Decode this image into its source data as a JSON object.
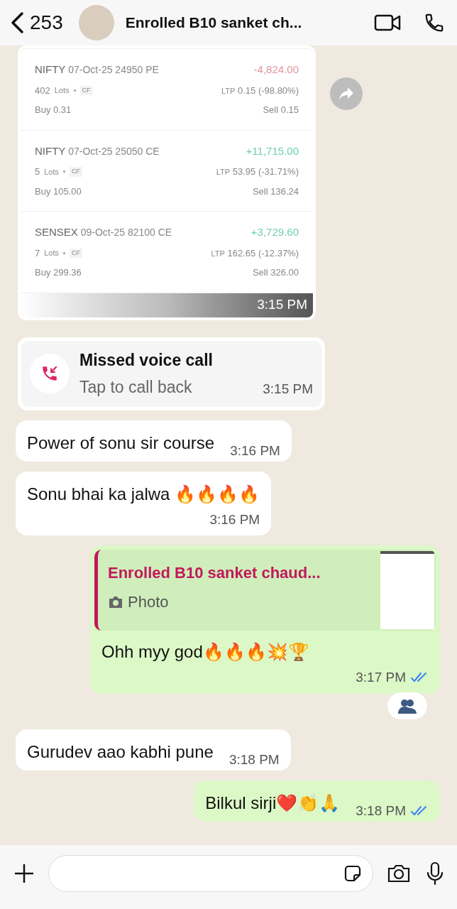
{
  "header": {
    "back_count": "253",
    "title": "Enrolled B10 sanket ch..."
  },
  "messages": [
    {
      "kind": "image",
      "time": "3:15 PM",
      "trades": [
        {
          "symbol": "NIFTY",
          "contract": "07-Oct-25 24950 PE",
          "pnl": "-4,824.00",
          "color": "#e2949c",
          "lots": "402",
          "lots_label": "Lots",
          "tag": "CF",
          "ltp_label": "LTP",
          "ltp": "0.15 (-98.80%)",
          "buy": "Buy 0.31",
          "sell": "Sell 0.15"
        },
        {
          "symbol": "NIFTY",
          "contract": "07-Oct-25 25050 CE",
          "pnl": "+11,715.00",
          "color": "#6fcfae",
          "lots": "5",
          "lots_label": "Lots",
          "tag": "CF",
          "ltp_label": "LTP",
          "ltp": "53.95 (-31.71%)",
          "buy": "Buy 105.00",
          "sell": "Sell 136.24"
        },
        {
          "symbol": "SENSEX",
          "contract": "09-Oct-25 82100 CE",
          "pnl": "+3,729.60",
          "color": "#6fcfae",
          "lots": "7",
          "lots_label": "Lots",
          "tag": "CF",
          "ltp_label": "LTP",
          "ltp": "162.65 (-12.37%)",
          "buy": "Buy 299.36",
          "sell": "Sell 326.00"
        }
      ]
    },
    {
      "kind": "missed_call",
      "title": "Missed voice call",
      "subtitle": "Tap to call back",
      "time": "3:15 PM"
    },
    {
      "kind": "incoming",
      "text": "Power of sonu sir course",
      "time": "3:16 PM"
    },
    {
      "kind": "incoming",
      "text": "Sonu bhai ka jalwa 🔥🔥🔥🔥",
      "time": "3:16 PM",
      "time_below": true
    },
    {
      "kind": "outgoing",
      "reply": {
        "author": "Enrolled B10 sanket chaud...",
        "label": "Photo"
      },
      "text": "Ohh myy god🔥🔥🔥💥🏆",
      "time": "3:17 PM",
      "read": true,
      "time_below": true,
      "reaction": true
    },
    {
      "kind": "incoming",
      "text": "Gurudev aao kabhi pune",
      "time": "3:18 PM"
    },
    {
      "kind": "outgoing",
      "text": "Bilkul sirji❤️👏🙏",
      "time": "3:18 PM",
      "read": true
    }
  ]
}
